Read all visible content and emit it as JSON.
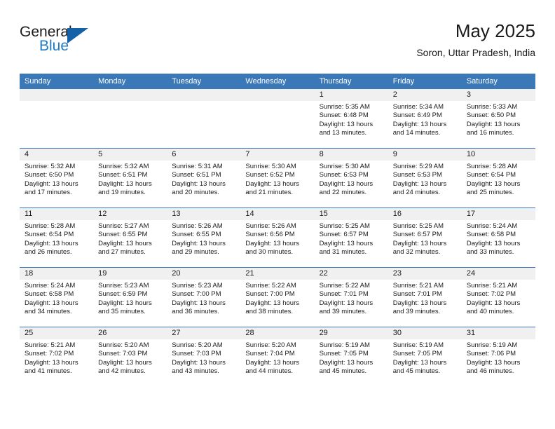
{
  "brand": {
    "name_line1": "General",
    "name_line2": "Blue",
    "triangle_color": "#1461a8",
    "blue_color": "#1f7ac4"
  },
  "header": {
    "title": "May 2025",
    "subtitle": "Soron, Uttar Pradesh, India"
  },
  "theme": {
    "header_bg": "#3b78b8",
    "header_text": "#ffffff",
    "date_strip_bg": "#f0f0f0",
    "row_divider": "#3b78b8",
    "body_text": "#1a1a1a"
  },
  "calendar": {
    "weekday_headers": [
      "Sunday",
      "Monday",
      "Tuesday",
      "Wednesday",
      "Thursday",
      "Friday",
      "Saturday"
    ],
    "leading_blanks": 4,
    "weeks": [
      [
        null,
        null,
        null,
        null,
        {
          "day": "1",
          "sunrise": "Sunrise: 5:35 AM",
          "sunset": "Sunset: 6:48 PM",
          "daylight_line1": "Daylight: 13 hours",
          "daylight_line2": "and 13 minutes."
        },
        {
          "day": "2",
          "sunrise": "Sunrise: 5:34 AM",
          "sunset": "Sunset: 6:49 PM",
          "daylight_line1": "Daylight: 13 hours",
          "daylight_line2": "and 14 minutes."
        },
        {
          "day": "3",
          "sunrise": "Sunrise: 5:33 AM",
          "sunset": "Sunset: 6:50 PM",
          "daylight_line1": "Daylight: 13 hours",
          "daylight_line2": "and 16 minutes."
        }
      ],
      [
        {
          "day": "4",
          "sunrise": "Sunrise: 5:32 AM",
          "sunset": "Sunset: 6:50 PM",
          "daylight_line1": "Daylight: 13 hours",
          "daylight_line2": "and 17 minutes."
        },
        {
          "day": "5",
          "sunrise": "Sunrise: 5:32 AM",
          "sunset": "Sunset: 6:51 PM",
          "daylight_line1": "Daylight: 13 hours",
          "daylight_line2": "and 19 minutes."
        },
        {
          "day": "6",
          "sunrise": "Sunrise: 5:31 AM",
          "sunset": "Sunset: 6:51 PM",
          "daylight_line1": "Daylight: 13 hours",
          "daylight_line2": "and 20 minutes."
        },
        {
          "day": "7",
          "sunrise": "Sunrise: 5:30 AM",
          "sunset": "Sunset: 6:52 PM",
          "daylight_line1": "Daylight: 13 hours",
          "daylight_line2": "and 21 minutes."
        },
        {
          "day": "8",
          "sunrise": "Sunrise: 5:30 AM",
          "sunset": "Sunset: 6:53 PM",
          "daylight_line1": "Daylight: 13 hours",
          "daylight_line2": "and 22 minutes."
        },
        {
          "day": "9",
          "sunrise": "Sunrise: 5:29 AM",
          "sunset": "Sunset: 6:53 PM",
          "daylight_line1": "Daylight: 13 hours",
          "daylight_line2": "and 24 minutes."
        },
        {
          "day": "10",
          "sunrise": "Sunrise: 5:28 AM",
          "sunset": "Sunset: 6:54 PM",
          "daylight_line1": "Daylight: 13 hours",
          "daylight_line2": "and 25 minutes."
        }
      ],
      [
        {
          "day": "11",
          "sunrise": "Sunrise: 5:28 AM",
          "sunset": "Sunset: 6:54 PM",
          "daylight_line1": "Daylight: 13 hours",
          "daylight_line2": "and 26 minutes."
        },
        {
          "day": "12",
          "sunrise": "Sunrise: 5:27 AM",
          "sunset": "Sunset: 6:55 PM",
          "daylight_line1": "Daylight: 13 hours",
          "daylight_line2": "and 27 minutes."
        },
        {
          "day": "13",
          "sunrise": "Sunrise: 5:26 AM",
          "sunset": "Sunset: 6:55 PM",
          "daylight_line1": "Daylight: 13 hours",
          "daylight_line2": "and 29 minutes."
        },
        {
          "day": "14",
          "sunrise": "Sunrise: 5:26 AM",
          "sunset": "Sunset: 6:56 PM",
          "daylight_line1": "Daylight: 13 hours",
          "daylight_line2": "and 30 minutes."
        },
        {
          "day": "15",
          "sunrise": "Sunrise: 5:25 AM",
          "sunset": "Sunset: 6:57 PM",
          "daylight_line1": "Daylight: 13 hours",
          "daylight_line2": "and 31 minutes."
        },
        {
          "day": "16",
          "sunrise": "Sunrise: 5:25 AM",
          "sunset": "Sunset: 6:57 PM",
          "daylight_line1": "Daylight: 13 hours",
          "daylight_line2": "and 32 minutes."
        },
        {
          "day": "17",
          "sunrise": "Sunrise: 5:24 AM",
          "sunset": "Sunset: 6:58 PM",
          "daylight_line1": "Daylight: 13 hours",
          "daylight_line2": "and 33 minutes."
        }
      ],
      [
        {
          "day": "18",
          "sunrise": "Sunrise: 5:24 AM",
          "sunset": "Sunset: 6:58 PM",
          "daylight_line1": "Daylight: 13 hours",
          "daylight_line2": "and 34 minutes."
        },
        {
          "day": "19",
          "sunrise": "Sunrise: 5:23 AM",
          "sunset": "Sunset: 6:59 PM",
          "daylight_line1": "Daylight: 13 hours",
          "daylight_line2": "and 35 minutes."
        },
        {
          "day": "20",
          "sunrise": "Sunrise: 5:23 AM",
          "sunset": "Sunset: 7:00 PM",
          "daylight_line1": "Daylight: 13 hours",
          "daylight_line2": "and 36 minutes."
        },
        {
          "day": "21",
          "sunrise": "Sunrise: 5:22 AM",
          "sunset": "Sunset: 7:00 PM",
          "daylight_line1": "Daylight: 13 hours",
          "daylight_line2": "and 38 minutes."
        },
        {
          "day": "22",
          "sunrise": "Sunrise: 5:22 AM",
          "sunset": "Sunset: 7:01 PM",
          "daylight_line1": "Daylight: 13 hours",
          "daylight_line2": "and 39 minutes."
        },
        {
          "day": "23",
          "sunrise": "Sunrise: 5:21 AM",
          "sunset": "Sunset: 7:01 PM",
          "daylight_line1": "Daylight: 13 hours",
          "daylight_line2": "and 39 minutes."
        },
        {
          "day": "24",
          "sunrise": "Sunrise: 5:21 AM",
          "sunset": "Sunset: 7:02 PM",
          "daylight_line1": "Daylight: 13 hours",
          "daylight_line2": "and 40 minutes."
        }
      ],
      [
        {
          "day": "25",
          "sunrise": "Sunrise: 5:21 AM",
          "sunset": "Sunset: 7:02 PM",
          "daylight_line1": "Daylight: 13 hours",
          "daylight_line2": "and 41 minutes."
        },
        {
          "day": "26",
          "sunrise": "Sunrise: 5:20 AM",
          "sunset": "Sunset: 7:03 PM",
          "daylight_line1": "Daylight: 13 hours",
          "daylight_line2": "and 42 minutes."
        },
        {
          "day": "27",
          "sunrise": "Sunrise: 5:20 AM",
          "sunset": "Sunset: 7:03 PM",
          "daylight_line1": "Daylight: 13 hours",
          "daylight_line2": "and 43 minutes."
        },
        {
          "day": "28",
          "sunrise": "Sunrise: 5:20 AM",
          "sunset": "Sunset: 7:04 PM",
          "daylight_line1": "Daylight: 13 hours",
          "daylight_line2": "and 44 minutes."
        },
        {
          "day": "29",
          "sunrise": "Sunrise: 5:19 AM",
          "sunset": "Sunset: 7:05 PM",
          "daylight_line1": "Daylight: 13 hours",
          "daylight_line2": "and 45 minutes."
        },
        {
          "day": "30",
          "sunrise": "Sunrise: 5:19 AM",
          "sunset": "Sunset: 7:05 PM",
          "daylight_line1": "Daylight: 13 hours",
          "daylight_line2": "and 45 minutes."
        },
        {
          "day": "31",
          "sunrise": "Sunrise: 5:19 AM",
          "sunset": "Sunset: 7:06 PM",
          "daylight_line1": "Daylight: 13 hours",
          "daylight_line2": "and 46 minutes."
        }
      ]
    ]
  }
}
